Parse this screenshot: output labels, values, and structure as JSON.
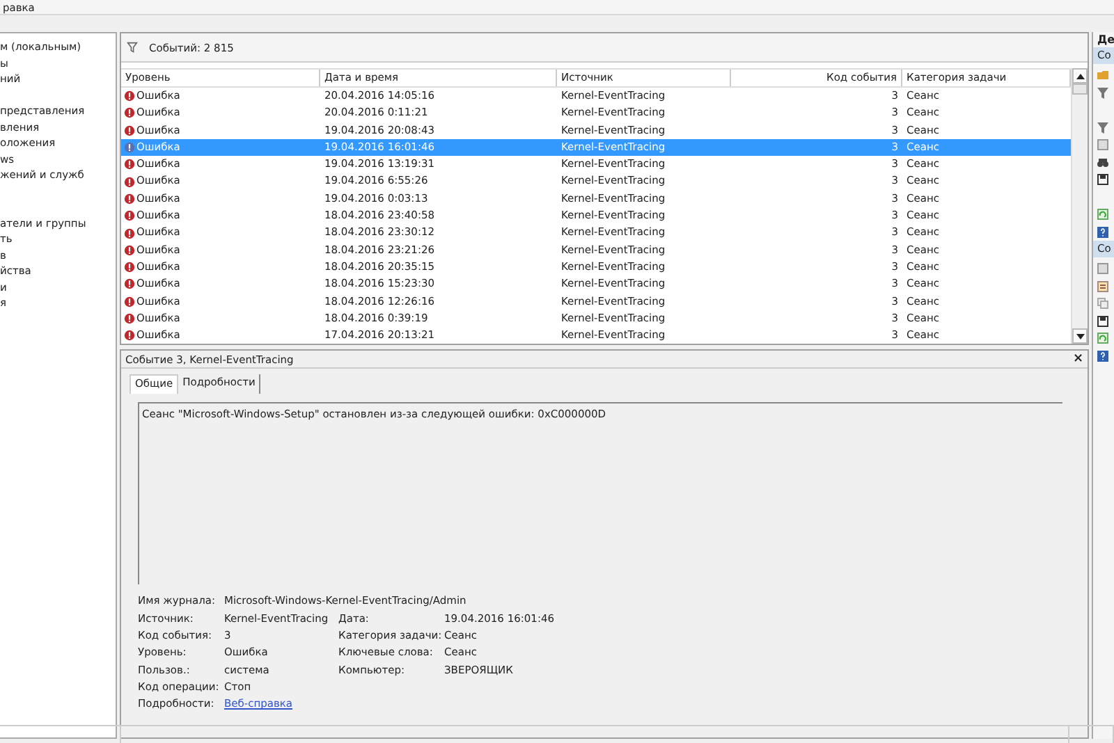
{
  "menu": {
    "items": [
      "равка"
    ]
  },
  "tree": {
    "items": [
      {
        "label": "м (локальным)"
      },
      {
        "label": "ы"
      },
      {
        "label": "ний"
      },
      {
        "label": "представления"
      },
      {
        "label": "вления"
      },
      {
        "label": "оложения"
      },
      {
        "label": "ws"
      },
      {
        "label": "жений и служб"
      },
      {
        "label": "атели и группы"
      },
      {
        "label": "ть"
      },
      {
        "label": "в"
      },
      {
        "label": "йства"
      },
      {
        "label": "и"
      },
      {
        "label": "я"
      }
    ]
  },
  "events": {
    "count": "Событий: 2 815",
    "columns": [
      "Уровень",
      "Дата и время",
      "Источник",
      "Код события",
      "Категория задачи"
    ],
    "rows": [
      {
        "level": "Ошибка",
        "kind": "error",
        "time": "20.04.2016 14:05:16",
        "source": "Kernel-EventTracing",
        "code": "3",
        "category": "Сеанс",
        "selected": false
      },
      {
        "level": "Ошибка",
        "kind": "error",
        "time": "20.04.2016 0:11:21",
        "source": "Kernel-EventTracing",
        "code": "3",
        "category": "Сеанс",
        "selected": false
      },
      {
        "level": "Ошибка",
        "kind": "error",
        "time": "19.04.2016 20:08:43",
        "source": "Kernel-EventTracing",
        "code": "3",
        "category": "Сеанс",
        "selected": false
      },
      {
        "level": "Ошибка",
        "kind": "error",
        "time": "19.04.2016 16:01:46",
        "source": "Kernel-EventTracing",
        "code": "3",
        "category": "Сеанс",
        "selected": true
      },
      {
        "level": "Ошибка",
        "kind": "error",
        "time": "19.04.2016 13:19:31",
        "source": "Kernel-EventTracing",
        "code": "3",
        "category": "Сеанс",
        "selected": false
      },
      {
        "level": "Ошибка",
        "kind": "error",
        "time": "19.04.2016 6:55:26",
        "source": "Kernel-EventTracing",
        "code": "3",
        "category": "Сеанс",
        "selected": false
      },
      {
        "level": "Ошибка",
        "kind": "error",
        "time": "19.04.2016 0:03:13",
        "source": "Kernel-EventTracing",
        "code": "3",
        "category": "Сеанс",
        "selected": false
      },
      {
        "level": "Ошибка",
        "kind": "error",
        "time": "18.04.2016 23:40:58",
        "source": "Kernel-EventTracing",
        "code": "3",
        "category": "Сеанс",
        "selected": false
      },
      {
        "level": "Ошибка",
        "kind": "error",
        "time": "18.04.2016 23:30:12",
        "source": "Kernel-EventTracing",
        "code": "3",
        "category": "Сеанс",
        "selected": false
      },
      {
        "level": "Ошибка",
        "kind": "error",
        "time": "18.04.2016 23:21:26",
        "source": "Kernel-EventTracing",
        "code": "3",
        "category": "Сеанс",
        "selected": false
      },
      {
        "level": "Ошибка",
        "kind": "error",
        "time": "18.04.2016 20:35:15",
        "source": "Kernel-EventTracing",
        "code": "3",
        "category": "Сеанс",
        "selected": false
      },
      {
        "level": "Ошибка",
        "kind": "error",
        "time": "18.04.2016 15:23:30",
        "source": "Kernel-EventTracing",
        "code": "3",
        "category": "Сеанс",
        "selected": false
      },
      {
        "level": "Ошибка",
        "kind": "error",
        "time": "18.04.2016 12:26:16",
        "source": "Kernel-EventTracing",
        "code": "3",
        "category": "Сеанс",
        "selected": false
      },
      {
        "level": "Ошибка",
        "kind": "error",
        "time": "18.04.2016 0:39:19",
        "source": "Kernel-EventTracing",
        "code": "3",
        "category": "Сеанс",
        "selected": false
      },
      {
        "level": "Ошибка",
        "kind": "error",
        "time": "17.04.2016 20:13:21",
        "source": "Kernel-EventTracing",
        "code": "3",
        "category": "Сеанс",
        "selected": false
      }
    ]
  },
  "details": {
    "title": "Событие 3, Kernel-EventTracing",
    "close": "×",
    "tabs": [
      {
        "label": "Общие",
        "selected": true
      },
      {
        "label": "Подробности",
        "selected": false
      }
    ],
    "message": "Сеанс \"Microsoft-Windows-Setup\" остановлен из-за следующей ошибки: 0xC000000D",
    "log_name": {
      "label": "Имя журнала:",
      "value": "Microsoft-Windows-Kernel-EventTracing/Admin"
    },
    "properties": [
      {
        "label": "Источник:",
        "value": "Kernel-EventTracing",
        "label2": "Дата:",
        "value2": "19.04.2016 16:01:46"
      },
      {
        "label": "Код события:",
        "value": "3",
        "label2": "Категория задачи:",
        "value2": "Сеанс"
      },
      {
        "label": "Уровень:",
        "value": "Ошибка",
        "label2": "Ключевые слова:",
        "value2": "Сеанс"
      },
      {
        "label": "Пользов.:",
        "value": "система",
        "label2": "Компьютер:",
        "value2": "ЗВЕРОЯЩИК"
      },
      {
        "label": "Код операции:",
        "value": "Стоп"
      }
    ],
    "more": {
      "label": "Подробности:",
      "link": "Веб-справка"
    }
  },
  "actions": {
    "title": "Де",
    "sections": [
      {
        "header": "Со"
      },
      {
        "header": "Со"
      }
    ]
  }
}
